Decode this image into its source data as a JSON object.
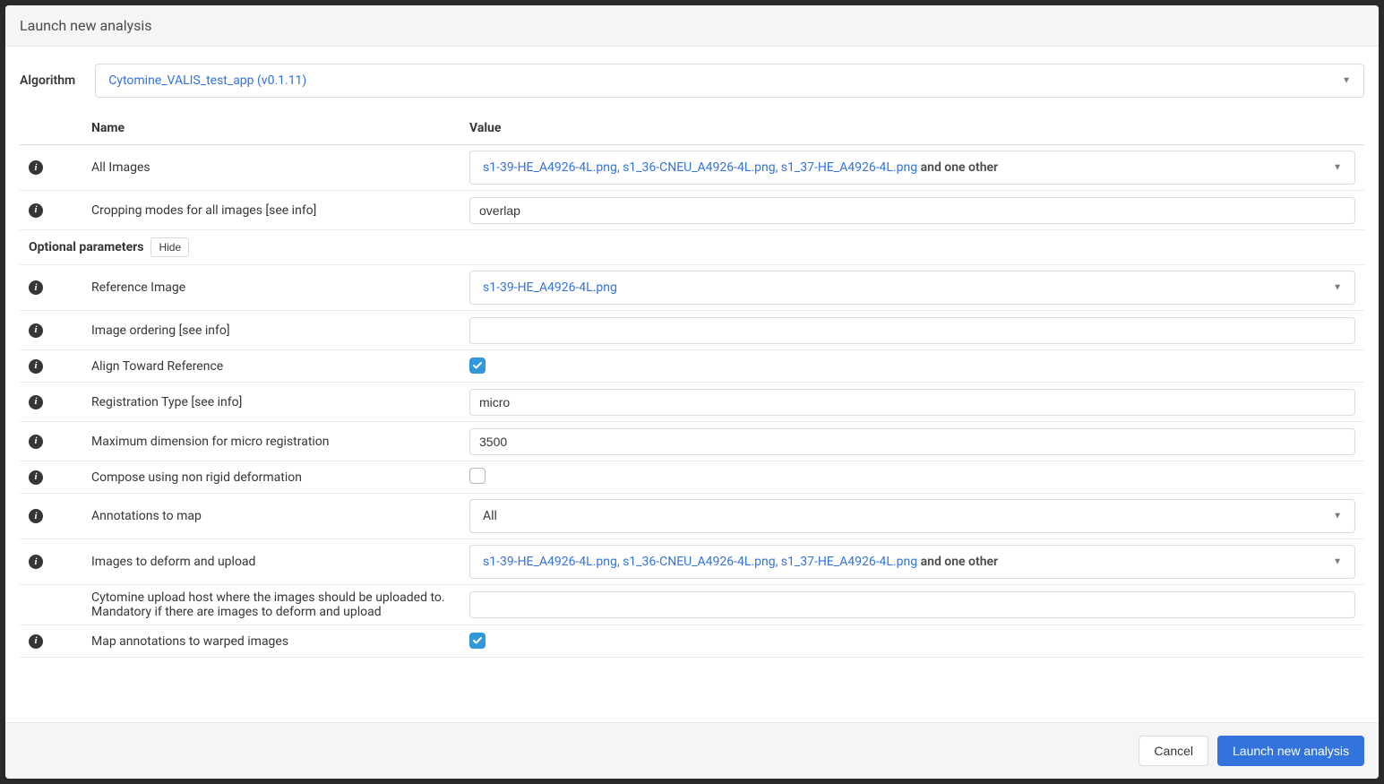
{
  "modal": {
    "title": "Launch new analysis"
  },
  "algorithm": {
    "label": "Algorithm",
    "value": "Cytomine_VALIS_test_app (v0.1.11)"
  },
  "columns": {
    "name": "Name",
    "value": "Value"
  },
  "optional": {
    "label": "Optional parameters",
    "toggle": "Hide"
  },
  "params": {
    "all_images": {
      "label": "All Images",
      "value_linked": "s1-39-HE_A4926-4L.png, s1_36-CNEU_A4926-4L.png, s1_37-HE_A4926-4L.png",
      "value_suffix": " and one other"
    },
    "cropping": {
      "label": "Cropping modes for all images [see info]",
      "value": "overlap"
    },
    "reference_image": {
      "label": "Reference Image",
      "value": "s1-39-HE_A4926-4L.png"
    },
    "image_ordering": {
      "label": "Image ordering [see info]",
      "value": ""
    },
    "align_toward_reference": {
      "label": "Align Toward Reference",
      "checked": true
    },
    "registration_type": {
      "label": "Registration Type [see info]",
      "value": "micro"
    },
    "max_dim": {
      "label": "Maximum dimension for micro registration",
      "value": "3500"
    },
    "compose_nonrigid": {
      "label": "Compose using non rigid deformation",
      "checked": false
    },
    "annotations_to_map": {
      "label": "Annotations to map",
      "value": "All"
    },
    "images_deform": {
      "label": "Images to deform and upload",
      "value_linked": "s1-39-HE_A4926-4L.png, s1_36-CNEU_A4926-4L.png, s1_37-HE_A4926-4L.png",
      "value_suffix": " and one other"
    },
    "upload_host": {
      "label": "Cytomine upload host where the images should be uploaded to. Mandatory if there are images to deform and upload",
      "value": ""
    },
    "map_annotations": {
      "label": "Map annotations to warped images",
      "checked": true
    }
  },
  "footer": {
    "cancel": "Cancel",
    "launch": "Launch new analysis"
  }
}
